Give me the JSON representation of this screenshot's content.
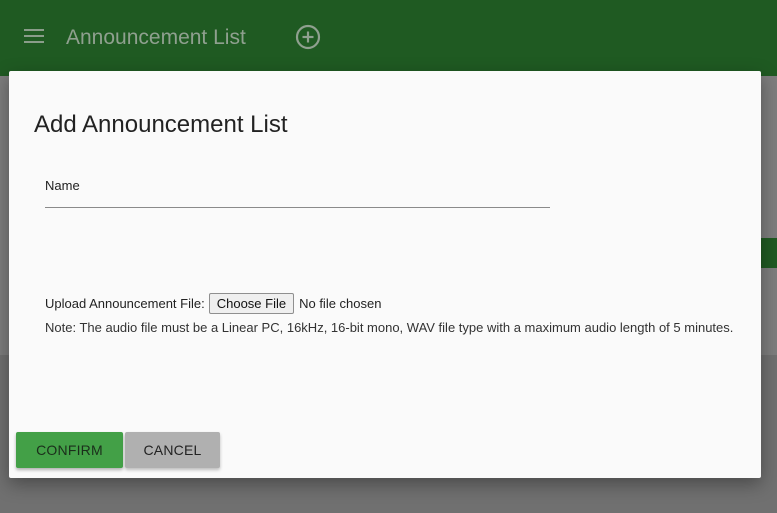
{
  "appbar": {
    "title": "Announcement List",
    "menu_icon": "menu-icon",
    "add_icon": "add-circle-icon",
    "color": "#2e7d32"
  },
  "dialog": {
    "title": "Add Announcement List",
    "name_label": "Name",
    "name_value": "",
    "upload_label": "Upload Announcement File:",
    "choose_file_label": "Choose File",
    "no_file_text": "No file chosen",
    "note": "Note: The audio file must be a Linear PC, 16kHz, 16-bit mono, WAV file type with a maximum audio length of 5 minutes.",
    "confirm_label": "CONFIRM",
    "cancel_label": "CANCEL",
    "confirm_color": "#43a047",
    "cancel_color": "#b0b0b0"
  }
}
